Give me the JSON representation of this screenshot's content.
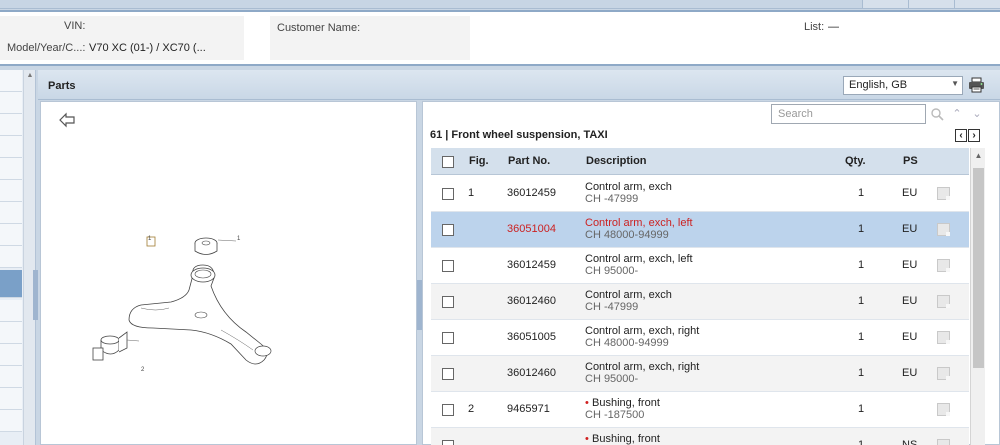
{
  "header": {
    "vin_label": "VIN:",
    "model_label": "Model/Year/C...:",
    "model_value": "V70 XC (01-) / XC70 (...",
    "customer_label": "Customer Name:",
    "list_label": "List:",
    "list_value": "—"
  },
  "parts": {
    "title": "Parts",
    "language": "English, GB"
  },
  "parts_list": {
    "search_placeholder": "Search",
    "group_title": "61  |  Front wheel suspension, TAXI",
    "columns": {
      "fig": "Fig.",
      "part_no": "Part No.",
      "description": "Description",
      "qty": "Qty.",
      "ps": "PS"
    },
    "rows": [
      {
        "fig": "1",
        "part_no": "36012459",
        "description": "Control arm, exch",
        "desc_sub": "CH -47999",
        "qty": "1",
        "ps": "EU"
      },
      {
        "fig": "",
        "part_no": "36051004",
        "description": "Control arm, exch, left",
        "desc_sub": "CH 48000-94999",
        "qty": "1",
        "ps": "EU"
      },
      {
        "fig": "",
        "part_no": "36012459",
        "description": "Control arm, exch, left",
        "desc_sub": "CH 95000-",
        "qty": "1",
        "ps": "EU"
      },
      {
        "fig": "",
        "part_no": "36012460",
        "description": "Control arm, exch",
        "desc_sub": "CH -47999",
        "qty": "1",
        "ps": "EU"
      },
      {
        "fig": "",
        "part_no": "36051005",
        "description": "Control arm, exch, right",
        "desc_sub": "CH 48000-94999",
        "qty": "1",
        "ps": "EU"
      },
      {
        "fig": "",
        "part_no": "36012460",
        "description": "Control arm, exch, right",
        "desc_sub": "CH 95000-",
        "qty": "1",
        "ps": "EU"
      },
      {
        "fig": "2",
        "part_no": "9465971",
        "description": "Bushing, front",
        "desc_sub": "CH -187500",
        "qty": "1",
        "ps": ""
      },
      {
        "fig": "",
        "part_no": "",
        "description": "Bushing, front",
        "desc_sub": "",
        "qty": "1",
        "ps": "NS"
      }
    ]
  },
  "illustration": {
    "callout_1": "1",
    "callout_2": "2",
    "callout_box": "1"
  },
  "colors": {
    "selected_row": "#bcd3ec",
    "selected_text": "#cc2222",
    "header_bg": "#d4e0ec"
  }
}
